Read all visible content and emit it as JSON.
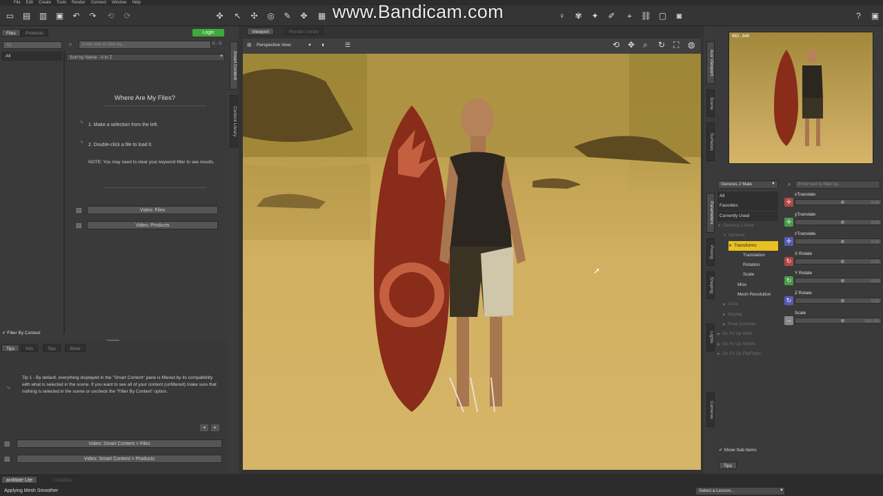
{
  "watermark": "www.Bandicam.com",
  "menu": [
    "File",
    "Edit",
    "Create",
    "Tools",
    "Render",
    "Connect",
    "Window",
    "Help"
  ],
  "left_panel": {
    "tabs": [
      "Files",
      "Products"
    ],
    "login_label": "Login",
    "category_filter": "All",
    "search_placeholder": "Enter text to filter by...",
    "count": "0 - 0",
    "sort_label": "Sort by Name : A to Z",
    "category_all": "All",
    "heading": "Where Are My Files?",
    "step1": "1. Make a selection from the left.",
    "step2": "2. Double-click a file to load it.",
    "note": "NOTE: You may need to clear your keyword filter to see results.",
    "video_files": "Video: Files",
    "video_products": "Video: Products",
    "filter_by_context": "Filter By Context"
  },
  "vertical_tabs_left": [
    "Smart Content",
    "Content Library"
  ],
  "tips_panel": {
    "tabs": [
      "Tips",
      "Info",
      "Tips",
      "Store"
    ],
    "tip_text": "Tip 1 - By default, everything displayed in the \"Smart Content\" pane is filtered by its compatibility with what is selected in the scene. If you want to see all of your content (unfiltered) make sure that nothing is selected in the scene or uncheck the \"Filter By Context\" option.",
    "btn_files": "Video: Smart Content > Files",
    "btn_products": "Video: Smart Content > Products"
  },
  "viewport": {
    "tabs": [
      "Viewport",
      "Render Library"
    ],
    "view_mode": "Perspective View"
  },
  "aux_viewport": {
    "label": "Aux Viewport",
    "coords": "983 , 848"
  },
  "right_vertical_tabs": [
    "Aux Viewport",
    "Scene",
    "Surfaces",
    "Parameters",
    "Posing",
    "Shaping",
    "Lights",
    "Cameras"
  ],
  "parameters": {
    "node_select": "Genesis 2 Male",
    "search_placeholder": "Enter text to filter by...",
    "tree": [
      {
        "label": "All",
        "indent": 0,
        "dim": false,
        "arrow": ""
      },
      {
        "label": "Favorites",
        "indent": 0,
        "dim": false,
        "arrow": ""
      },
      {
        "label": "Currently Used",
        "indent": 0,
        "dim": false,
        "arrow": ""
      },
      {
        "label": "Genesis 2 Male",
        "indent": 0,
        "dim": true,
        "arrow": "▼"
      },
      {
        "label": "General",
        "indent": 1,
        "dim": true,
        "arrow": "▼"
      },
      {
        "label": "Transforms",
        "indent": 2,
        "dim": false,
        "arrow": "▼",
        "selected": true
      },
      {
        "label": "Translation",
        "indent": 3,
        "dim": false,
        "arrow": ""
      },
      {
        "label": "Rotation",
        "indent": 3,
        "dim": false,
        "arrow": ""
      },
      {
        "label": "Scale",
        "indent": 3,
        "dim": false,
        "arrow": ""
      },
      {
        "label": "Misc",
        "indent": 2,
        "dim": false,
        "arrow": ""
      },
      {
        "label": "Mesh Resolution",
        "indent": 2,
        "dim": false,
        "arrow": ""
      },
      {
        "label": "Actor",
        "indent": 1,
        "dim": true,
        "arrow": "▶"
      },
      {
        "label": "Display",
        "indent": 1,
        "dim": true,
        "arrow": "▶"
      },
      {
        "label": "Pose Controls",
        "indent": 1,
        "dim": true,
        "arrow": "▶"
      },
      {
        "label": "Go Fx Up Shirt",
        "indent": 0,
        "dim": true,
        "arrow": "▶"
      },
      {
        "label": "Go Fx Up Shorts",
        "indent": 0,
        "dim": true,
        "arrow": "▶"
      },
      {
        "label": "Go Fx Up FlipFlops",
        "indent": 0,
        "dim": true,
        "arrow": "▶"
      }
    ],
    "sliders": [
      {
        "label": "xTranslate",
        "value": "0.00",
        "color": "#b04848"
      },
      {
        "label": "yTranslate",
        "value": "0.00",
        "color": "#4a9a4a"
      },
      {
        "label": "zTranslate",
        "value": "0.00",
        "color": "#5a5ab8"
      },
      {
        "label": "X Rotate",
        "value": "0.00",
        "color": "#b04848"
      },
      {
        "label": "Y Rotate",
        "value": "0.00",
        "color": "#4a9a4a"
      },
      {
        "label": "Z Rotate",
        "value": "0.00",
        "color": "#5a5ab8"
      },
      {
        "label": "Scale",
        "value": "100.0%",
        "color": "#888888"
      }
    ],
    "show_sub_items": "Show Sub Items",
    "tips_tab": "Tips"
  },
  "status": {
    "tab1": "aniMate Lite",
    "tab2": "Timeline",
    "message": "Applying Mesh Smoother",
    "lesson_select": "Select a Lesson..."
  }
}
